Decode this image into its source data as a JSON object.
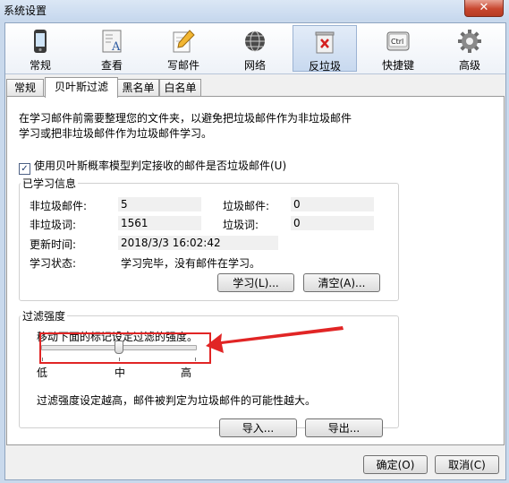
{
  "window": {
    "title": "系统设置",
    "close_glyph": "✕"
  },
  "toolbar": {
    "items": [
      {
        "label": "常规",
        "icon": "phone-icon"
      },
      {
        "label": "查看",
        "icon": "book-icon"
      },
      {
        "label": "写邮件",
        "icon": "pencil-icon"
      },
      {
        "label": "网络",
        "icon": "globe-icon"
      },
      {
        "label": "反垃圾",
        "icon": "trash-icon",
        "active": true
      },
      {
        "label": "快捷键",
        "icon": "keyboard-ctrl-icon"
      },
      {
        "label": "高级",
        "icon": "gear-icon"
      }
    ],
    "ctrl_text": "Ctrl"
  },
  "subtabs": [
    "常规",
    "贝叶斯过滤",
    "黑名单",
    "白名单"
  ],
  "intro_text": "在学习邮件前需要整理您的文件夹，以避免把垃圾邮件作为非垃圾邮件学习或把非垃圾邮件作为垃圾邮件学习。",
  "use_bayes": {
    "label": "使用贝叶斯概率模型判定接收的邮件是否垃圾邮件(U)",
    "checked": true,
    "check_glyph": "✓"
  },
  "learned_info": {
    "legend": "已学习信息",
    "non_spam_mail_label": "非垃圾邮件:",
    "non_spam_mail_value": "5",
    "spam_mail_label": "垃圾邮件:",
    "spam_mail_value": "0",
    "non_spam_word_label": "非垃圾词:",
    "non_spam_word_value": "1561",
    "spam_word_label": "垃圾词:",
    "spam_word_value": "0",
    "update_time_label": "更新时间:",
    "update_time_value": "2018/3/3 16:02:42",
    "status_label": "学习状态:",
    "status_value": "学习完毕，没有邮件在学习。",
    "learn_button": "学习(L)...",
    "clear_button": "清空(A)..."
  },
  "filter_strength": {
    "legend": "过滤强度",
    "instruction": "移动下面的标记设定过滤的强度。",
    "low_label": "低",
    "mid_label": "中",
    "high_label": "高",
    "level": 0.5,
    "description": "过滤强度设定越高，邮件被判定为垃圾邮件的可能性越大。"
  },
  "import_button": "导入...",
  "export_button": "导出...",
  "ok_button": "确定(O)",
  "cancel_button": "取消(C)",
  "colors": {
    "annotation_red": "#e12525",
    "toolbar_active": "#c8d9ef"
  }
}
